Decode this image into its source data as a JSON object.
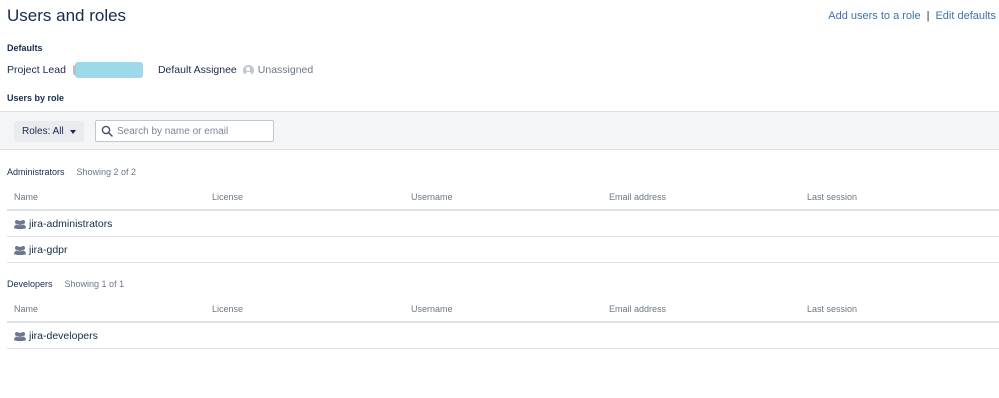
{
  "page": {
    "title": "Users and roles",
    "actions": {
      "add_users_label": "Add users to a role",
      "separator": "|",
      "edit_defaults_label": "Edit defaults"
    }
  },
  "defaults": {
    "heading": "Defaults",
    "project_lead_label": "Project Lead",
    "default_assignee_label": "Default Assignee",
    "default_assignee_value": "Unassigned"
  },
  "users_by_role": {
    "heading": "Users by role",
    "roles_filter_label": "Roles: All",
    "search_placeholder": "Search by name or email"
  },
  "columns": {
    "name": "Name",
    "license": "License",
    "username": "Username",
    "email": "Email address",
    "last_session": "Last session"
  },
  "groups": [
    {
      "role": "Administrators",
      "count_text": "Showing 2 of 2",
      "rows": [
        {
          "name": "jira-administrators",
          "icon": "group-icon"
        },
        {
          "name": "jira-gdpr",
          "icon": "group-icon"
        }
      ]
    },
    {
      "role": "Developers",
      "count_text": "Showing 1 of 1",
      "rows": [
        {
          "name": "jira-developers",
          "icon": "group-icon"
        }
      ]
    }
  ],
  "colors": {
    "link": "#3b73af",
    "redaction": "#9ed9ea",
    "filter_bar": "#f4f5f7"
  }
}
